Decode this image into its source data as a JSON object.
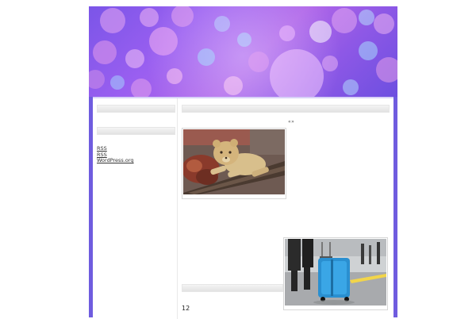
{
  "sidebar": {
    "links": [
      "RSS",
      "RSS",
      "WordPress.org"
    ]
  },
  "main": {
    "post_marker": "«»",
    "footer_number": "12"
  },
  "colors": {
    "frame": "#6f5cdf",
    "banner_primary": "#8e58e6"
  },
  "images": {
    "first": "lion-cub-photo",
    "second": "rolling-suitcase-photo"
  }
}
